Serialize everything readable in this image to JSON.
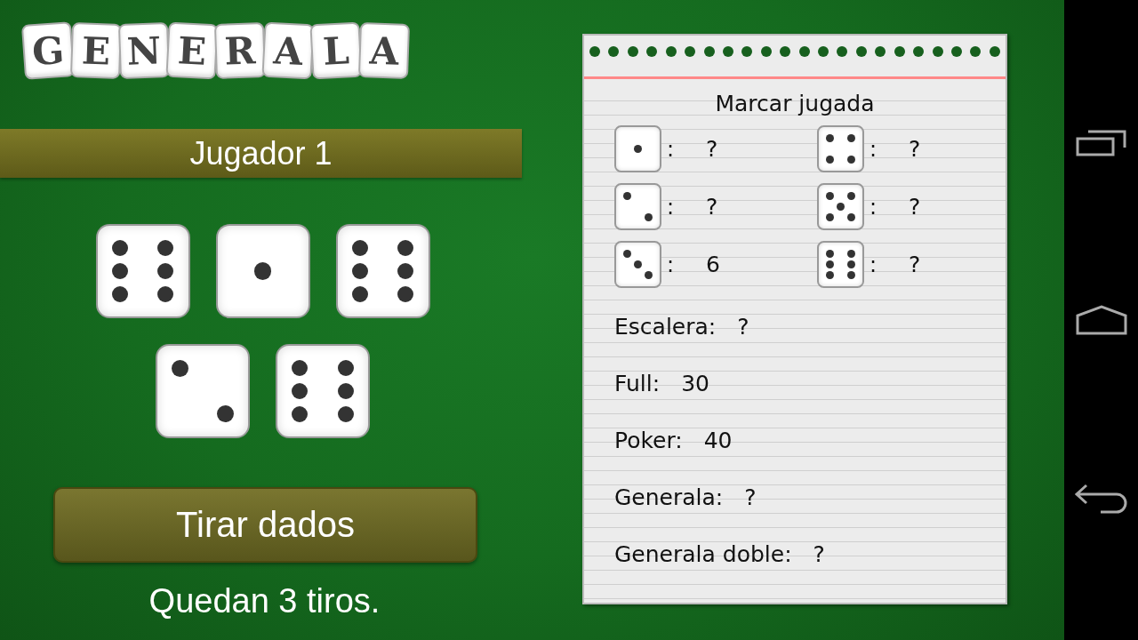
{
  "logo": {
    "letters": [
      "G",
      "E",
      "N",
      "E",
      "R",
      "A",
      "L",
      "A"
    ]
  },
  "player_banner": {
    "label": "Jugador 1"
  },
  "dice": [
    {
      "kind": "six"
    },
    {
      "kind": "one"
    },
    {
      "kind": "six"
    },
    {
      "kind": "two"
    },
    {
      "kind": "six"
    }
  ],
  "roll_button": {
    "label": "Tirar dados"
  },
  "status": "Quedan 3 tiros.",
  "score_sheet": {
    "title": "Marcar jugada",
    "number_rows": [
      {
        "left": {
          "kind": "one",
          "separator": ":",
          "value": "?"
        },
        "right": {
          "kind": "four",
          "separator": ":",
          "value": "?"
        }
      },
      {
        "left": {
          "kind": "two",
          "separator": ":",
          "value": "?"
        },
        "right": {
          "kind": "five",
          "separator": ":",
          "value": "?"
        }
      },
      {
        "left": {
          "kind": "three",
          "separator": ":",
          "value": "6"
        },
        "right": {
          "kind": "six",
          "separator": ":",
          "value": "?"
        }
      }
    ],
    "plays": [
      {
        "label": "Escalera:",
        "value": "?"
      },
      {
        "label": "Full:",
        "value": "30"
      },
      {
        "label": "Poker:",
        "value": "40"
      },
      {
        "label": "Generala:",
        "value": "?"
      },
      {
        "label": "Generala doble:",
        "value": "?"
      }
    ]
  },
  "nav_bar": {
    "buttons": [
      {
        "kind": "recents"
      },
      {
        "kind": "home"
      },
      {
        "kind": "back"
      }
    ]
  }
}
